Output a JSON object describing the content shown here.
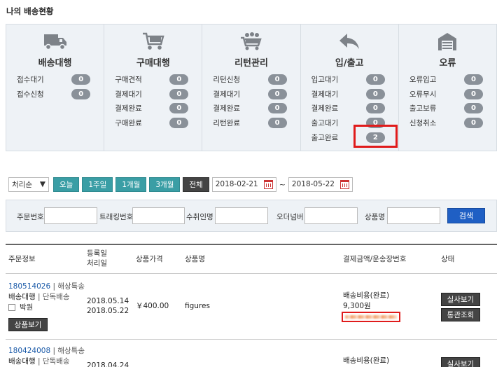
{
  "page_title": "나의 배송현황",
  "status_columns": [
    {
      "title": "배송대행",
      "icon": "truck-icon",
      "rows": [
        {
          "label": "접수대기",
          "count": "0"
        },
        {
          "label": "접수신청",
          "count": "0"
        }
      ]
    },
    {
      "title": "구매대행",
      "icon": "shopping-cart-icon",
      "rows": [
        {
          "label": "구매견적",
          "count": "0"
        },
        {
          "label": "결제대기",
          "count": "0"
        },
        {
          "label": "결제완료",
          "count": "0"
        },
        {
          "label": "구매완료",
          "count": "0"
        }
      ]
    },
    {
      "title": "리턴관리",
      "icon": "return-cart-icon",
      "rows": [
        {
          "label": "리턴신청",
          "count": "0"
        },
        {
          "label": "결제대기",
          "count": "0"
        },
        {
          "label": "결제완료",
          "count": "0"
        },
        {
          "label": "리턴완료",
          "count": "0"
        }
      ]
    },
    {
      "title": "입/출고",
      "icon": "reply-arrow-icon",
      "rows": [
        {
          "label": "입고대기",
          "count": "0"
        },
        {
          "label": "결제대기",
          "count": "0"
        },
        {
          "label": "결제완료",
          "count": "0"
        },
        {
          "label": "출고대기",
          "count": "0"
        },
        {
          "label": "출고완료",
          "count": "2"
        }
      ]
    },
    {
      "title": "오류",
      "icon": "warehouse-icon",
      "rows": [
        {
          "label": "오류입고",
          "count": "0"
        },
        {
          "label": "오류무시",
          "count": "0"
        },
        {
          "label": "출고보류",
          "count": "0"
        },
        {
          "label": "신청취소",
          "count": "0"
        }
      ]
    }
  ],
  "filter": {
    "sort_value": "처리순",
    "periods": [
      "오늘",
      "1주일",
      "1개월",
      "3개월",
      "전체"
    ],
    "date_from": "2018-02-21",
    "date_to": "2018-05-22",
    "range_separator": "~"
  },
  "search": {
    "order_no_label": "주문번호",
    "tracking_label": "트래킹번호",
    "recipient_label": "수취인명",
    "order_number_label": "오더넘버",
    "product_label": "상품명",
    "button_label": "검색"
  },
  "table": {
    "headers": {
      "order_info": "주문정보",
      "date_line1": "등록일",
      "date_line2": "처리일",
      "price": "상품가격",
      "product": "상품명",
      "payment": "결제금액/운송장번호",
      "status": "상태"
    },
    "rows": [
      {
        "order_no": "180514026",
        "order_tag": "| 해상특송",
        "type_main": "배송대행",
        "type_sub": "| 단독배송",
        "recipient": "박원",
        "detail_button": "상품보기",
        "registered": "2018.05.14",
        "processed": "2018.05.22",
        "price": "￥400.00",
        "product_name": "figures",
        "cost_label": "배송비용(완료)",
        "cost_amount": "9,300원",
        "btn_photo": "실사보기",
        "btn_customs": "통관조회"
      },
      {
        "order_no": "180424008",
        "order_tag": "| 해상특송",
        "type_main": "배송대행",
        "type_sub": "| 단독배송",
        "registered": "2018.04.24",
        "cost_label": "배송비용(완료)",
        "btn_photo": "실사보기"
      }
    ]
  },
  "colors": {
    "teal_button": "#3a9ea5",
    "search_blue": "#1f5fc4",
    "highlight_red": "#e01b1b",
    "badge_gray": "#8a9199"
  }
}
